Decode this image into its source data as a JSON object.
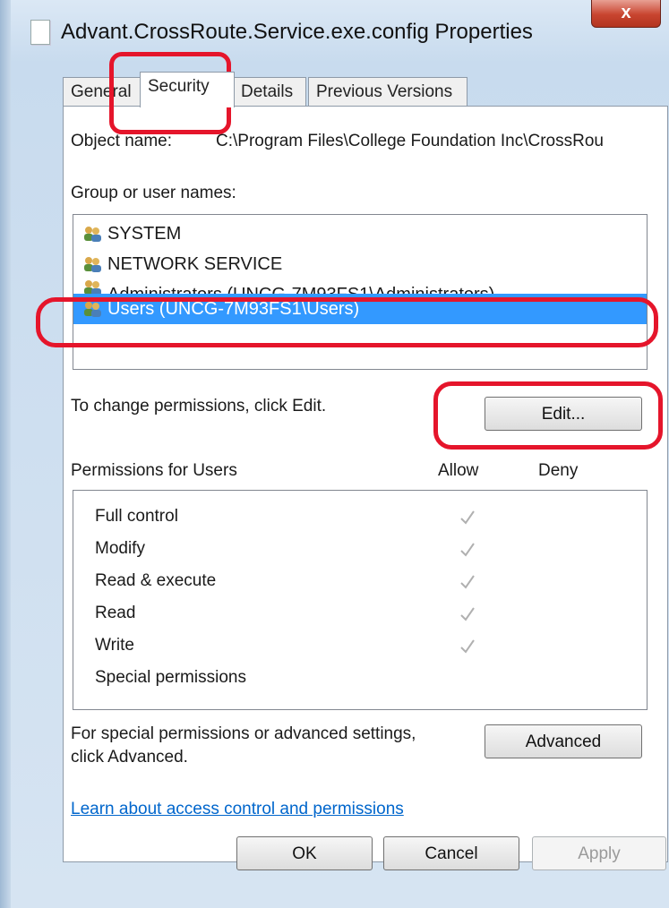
{
  "window": {
    "title": "Advant.CrossRoute.Service.exe.config Properties",
    "close_label": "x"
  },
  "tabs": [
    {
      "label": "General",
      "active": false
    },
    {
      "label": "Security",
      "active": true
    },
    {
      "label": "Details",
      "active": false
    },
    {
      "label": "Previous Versions",
      "active": false
    }
  ],
  "security": {
    "object_name_label": "Object name:",
    "object_name_value": "C:\\Program Files\\College Foundation Inc\\CrossRou",
    "group_label": "Group or user names:",
    "users": [
      {
        "name": "SYSTEM",
        "selected": false
      },
      {
        "name": "NETWORK SERVICE",
        "selected": false
      },
      {
        "name": "Administrators (UNCG-7M93FS1\\Administrators)",
        "selected": false
      },
      {
        "name": "Users (UNCG-7M93FS1\\Users)",
        "selected": true
      }
    ],
    "change_text": "To change permissions, click Edit.",
    "edit_button": "Edit...",
    "permissions_title": "Permissions for Users",
    "allow_header": "Allow",
    "deny_header": "Deny",
    "permissions": [
      {
        "name": "Full control",
        "allow": true,
        "deny": false
      },
      {
        "name": "Modify",
        "allow": true,
        "deny": false
      },
      {
        "name": "Read & execute",
        "allow": true,
        "deny": false
      },
      {
        "name": "Read",
        "allow": true,
        "deny": false
      },
      {
        "name": "Write",
        "allow": true,
        "deny": false
      },
      {
        "name": "Special permissions",
        "allow": false,
        "deny": false
      }
    ],
    "advanced_text_1": "For special permissions or advanced settings,",
    "advanced_text_2": "click Advanced.",
    "advanced_button": "Advanced",
    "learn_link": "Learn about access control and permissions"
  },
  "buttons": {
    "ok": "OK",
    "cancel": "Cancel",
    "apply": "Apply"
  },
  "colors": {
    "selection": "#3399ff",
    "highlight_annotation": "#e5152b",
    "link": "#0066cc"
  },
  "icons": {
    "file": "file-icon",
    "user_group": "user-group-icon",
    "check": "checkmark-icon",
    "close": "close-icon"
  }
}
